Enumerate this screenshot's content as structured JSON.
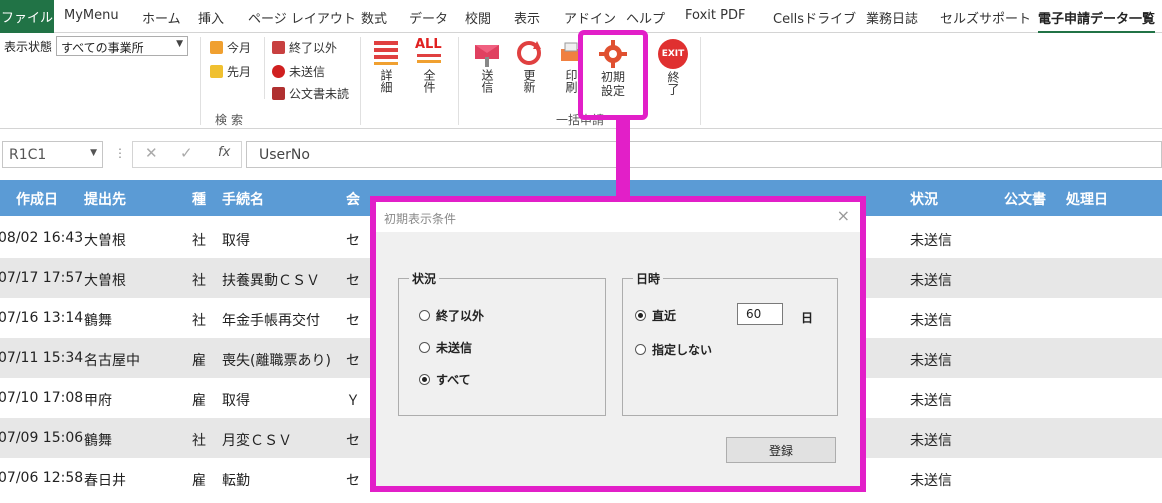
{
  "tabs": [
    "ファイル",
    "MyMenu",
    "ホーム",
    "挿入",
    "ページ レイアウト",
    "数式",
    "データ",
    "校閲",
    "表示",
    "アドイン",
    "ヘルプ",
    "Foxit PDF",
    "Cellsドライブ",
    "業務日誌",
    "セルズサポート",
    "電子申請データ一覧"
  ],
  "ribbon": {
    "status_label": "表示状態",
    "status_value": "すべての事業所",
    "this_month": "今月",
    "last_month": "先月",
    "not_done": "終了以外",
    "not_sent": "未送信",
    "unread": "公文書未読",
    "group_search": "検索",
    "detail": "詳細",
    "all": "全件",
    "send": "送信",
    "update": "更新",
    "print": "印刷",
    "init1": "初期",
    "init2": "設定",
    "exit": "終了",
    "exit_icon_text": "EXIT",
    "all_icon_text": "ALL",
    "group_batch": "一括申請"
  },
  "formula": {
    "namebox": "R1C1",
    "value": "UserNo"
  },
  "table": {
    "headers": [
      "作成日",
      "提出先",
      "種",
      "手続名",
      "会",
      "状況",
      "公文書",
      "処理日"
    ],
    "rows": [
      {
        "date": "08/02 16:43",
        "to": "大曽根",
        "kind": "社",
        "proc": "取得",
        "co": "セ",
        "status": "未送信"
      },
      {
        "date": "07/17 17:57",
        "to": "大曽根",
        "kind": "社",
        "proc": "扶養異動ＣＳＶ",
        "co": "セ",
        "status": "未送信"
      },
      {
        "date": "07/16 13:14",
        "to": "鶴舞",
        "kind": "社",
        "proc": "年金手帳再交付",
        "co": "セ",
        "status": "未送信"
      },
      {
        "date": "07/11 15:34",
        "to": "名古屋中",
        "kind": "雇",
        "proc": "喪失(離職票あり)",
        "co": "セ",
        "status": "未送信"
      },
      {
        "date": "07/10 17:08",
        "to": "甲府",
        "kind": "雇",
        "proc": "取得",
        "co": "Ｙ",
        "status": "未送信"
      },
      {
        "date": "07/09 15:06",
        "to": "鶴舞",
        "kind": "社",
        "proc": "月変ＣＳＶ",
        "co": "セ",
        "status": "未送信"
      },
      {
        "date": "07/06 12:58",
        "to": "春日井",
        "kind": "雇",
        "proc": "転勤",
        "co": "セ",
        "status": "未送信"
      }
    ]
  },
  "dialog": {
    "title": "初期表示条件",
    "close": "×",
    "status_group": "状況",
    "opt_not_done": "終了以外",
    "opt_not_sent": "未送信",
    "opt_all": "すべて",
    "date_group": "日時",
    "opt_recent": "直近",
    "days_value": "60",
    "days_unit": "日",
    "opt_none": "指定しない",
    "register": "登録"
  }
}
